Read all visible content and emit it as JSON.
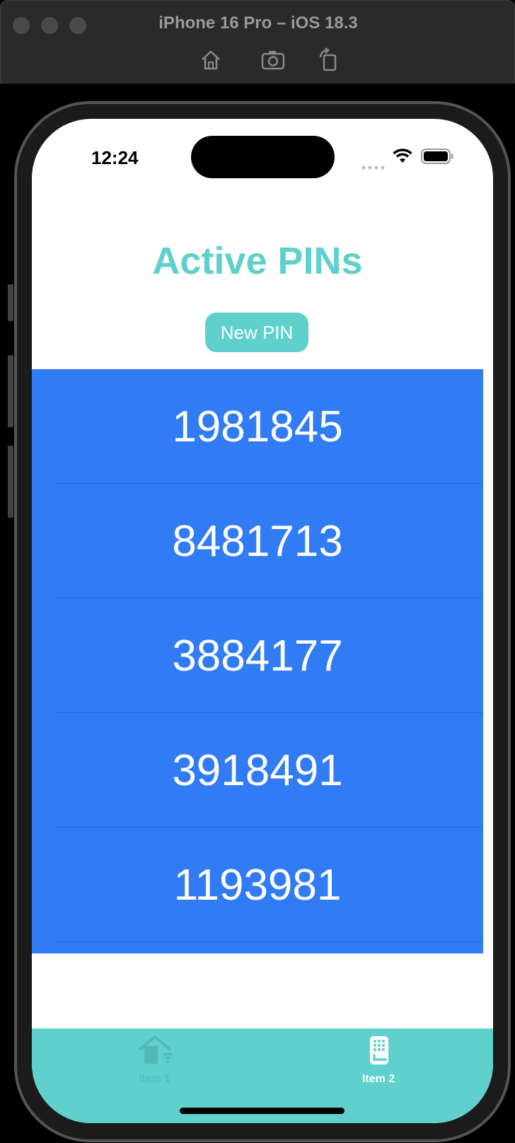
{
  "simulator": {
    "title": "iPhone 16 Pro – iOS 18.3",
    "tools": [
      "home-icon",
      "screenshot-icon",
      "rotate-icon"
    ]
  },
  "status_bar": {
    "time": "12:24"
  },
  "page": {
    "title": "Active PINs",
    "new_pin_label": "New PIN",
    "pins": [
      "1981845",
      "8481713",
      "3884177",
      "3918491",
      "1193981"
    ]
  },
  "tab_bar": {
    "items": [
      {
        "label": "Item 1",
        "icon": "home-wifi-icon",
        "selected": false
      },
      {
        "label": "Item 2",
        "icon": "keypad-lock-icon",
        "selected": true
      }
    ]
  },
  "colors": {
    "accent": "#5fd0cc",
    "list_background": "#317cf5",
    "pin_text": "#ffffff"
  }
}
